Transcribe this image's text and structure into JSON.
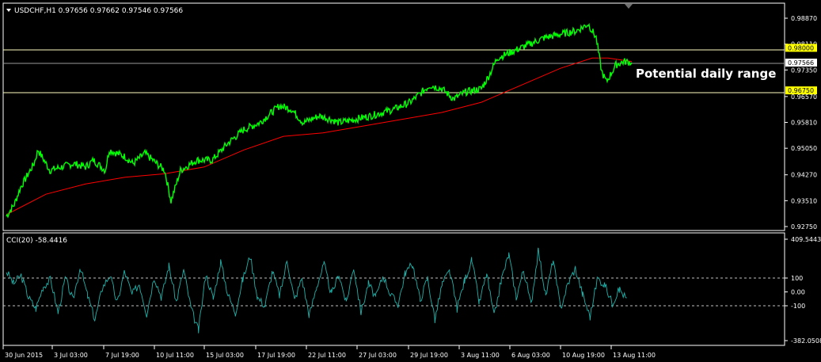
{
  "header": {
    "symbol_line": "USDCHF,H1  0.97656 0.97662 0.97546 0.97566",
    "cci_label": "CCI(20) -58.4416"
  },
  "annotation": "Potential daily range",
  "colors": {
    "background": "#000000",
    "price": "#00ff00",
    "ma": "#ff0000",
    "cci": "#20b2aa",
    "hline": "#ffff80",
    "label_bg": "#ffff00"
  },
  "chart_data": [
    {
      "type": "line",
      "title": "USDCHF,H1",
      "y_ticks": [
        "0.98870",
        "0.98110",
        "0.97350",
        "0.96570",
        "0.95810",
        "0.95050",
        "0.94270",
        "0.93510",
        "0.92750"
      ],
      "ylim": [
        0.9275,
        0.99
      ],
      "series": [
        {
          "name": "",
          "x": [
            0,
            10,
            18,
            35,
            40,
            55,
            70,
            85,
            100,
            110,
            125,
            130,
            150,
            160,
            175,
            185,
            200,
            208,
            220,
            240,
            260,
            280,
            300,
            320,
            345,
            360,
            375,
            395,
            410,
            420,
            440,
            460,
            475,
            490,
            510,
            520,
            535,
            550,
            565,
            580,
            600,
            610,
            620,
            640,
            660,
            680,
            700,
            720,
            735,
            745,
            752,
            758,
            770,
            780,
            790
          ],
          "values": [
            0.9305,
            0.934,
            0.939,
            0.946,
            0.95,
            0.944,
            0.945,
            0.946,
            0.945,
            0.947,
            0.944,
            0.95,
            0.948,
            0.946,
            0.949,
            0.947,
            0.944,
            0.935,
            0.944,
            0.947,
            0.947,
            0.952,
            0.956,
            0.958,
            0.963,
            0.962,
            0.958,
            0.96,
            0.959,
            0.958,
            0.959,
            0.96,
            0.961,
            0.962,
            0.964,
            0.966,
            0.969,
            0.968,
            0.965,
            0.967,
            0.968,
            0.972,
            0.977,
            0.979,
            0.981,
            0.983,
            0.984,
            0.985,
            0.987,
            0.983,
            0.973,
            0.97,
            0.975,
            0.976,
            0.9757
          ]
        },
        {
          "name": "",
          "x": [
            0,
            50,
            100,
            150,
            200,
            250,
            300,
            350,
            400,
            450,
            500,
            550,
            600,
            650,
            700,
            740,
            760,
            790
          ],
          "values": [
            0.931,
            0.937,
            0.94,
            0.942,
            0.943,
            0.945,
            0.95,
            0.954,
            0.955,
            0.957,
            0.959,
            0.961,
            0.964,
            0.969,
            0.974,
            0.977,
            0.977,
            0.976
          ]
        }
      ],
      "hlines": [
        {
          "value": "0.98000",
          "label": "0.98000"
        },
        {
          "value": "0.97566",
          "label": "0.97566"
        },
        {
          "value": "0.96750",
          "label": "0.96750"
        }
      ]
    },
    {
      "type": "line",
      "title": "CCI(20) -58.4416",
      "y_ticks": [
        "409.5443",
        "100",
        "0.00",
        "-100",
        "-382.0508"
      ],
      "ylim": [
        -382.0508,
        409.5443
      ],
      "levels": [
        100,
        -100
      ],
      "series": [
        {
          "name": "",
          "values": [
            150,
            60,
            120,
            -40,
            -120,
            40,
            90,
            -150,
            100,
            -60,
            180,
            -30,
            -200,
            30,
            120,
            -80,
            150,
            -20,
            60,
            -160,
            110,
            -40,
            190,
            -70,
            160,
            -120,
            -280,
            130,
            -50,
            220,
            -20,
            -150,
            90,
            260,
            -40,
            -100,
            150,
            -30,
            230,
            -60,
            100,
            -170,
            40,
            200,
            -20,
            130,
            -80,
            180,
            -150,
            60,
            -40,
            120,
            -20,
            -90,
            140,
            200,
            -60,
            100,
            -200,
            60,
            150,
            -120,
            80,
            230,
            -80,
            130,
            -180,
            90,
            270,
            -40,
            160,
            -90,
            300,
            -30,
            230,
            -120,
            60,
            170,
            -20,
            -180,
            100,
            50,
            -80,
            20,
            -58
          ]
        }
      ]
    }
  ],
  "x_axis": [
    "30 Jun 2015",
    "3 Jul 03:00",
    "7 Jul 19:00",
    "10 Jul 11:00",
    "15 Jul 03:00",
    "17 Jul 19:00",
    "22 Jul 11:00",
    "27 Jul 03:00",
    "29 Jul 19:00",
    "3 Aug 11:00",
    "6 Aug 03:00",
    "10 Aug 19:00",
    "13 Aug 11:00"
  ]
}
